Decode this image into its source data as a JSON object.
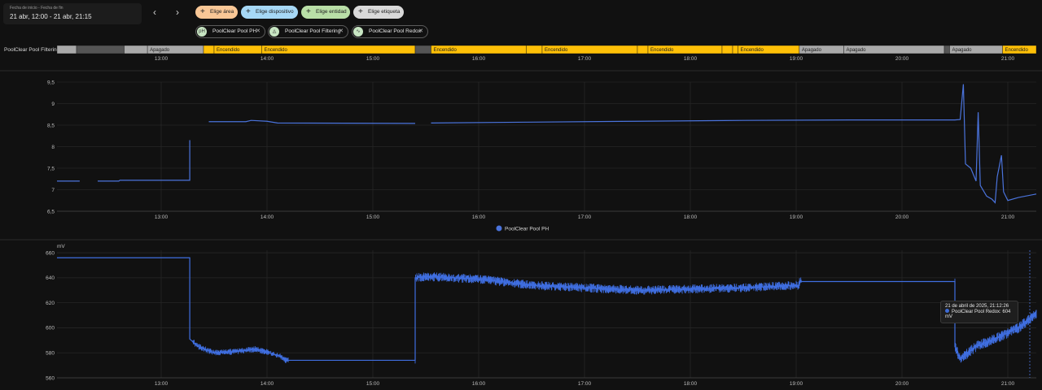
{
  "date_range": {
    "label": "Fecha de inicio - Fecha de fin",
    "value": "21 abr, 12:00 - 21 abr, 21:15"
  },
  "nav": {
    "prev": "‹",
    "next": "›"
  },
  "filters": {
    "area": "Elige área",
    "device": "Elige dispositivo",
    "entity": "Elige entidad",
    "tag": "Elige etiqueta"
  },
  "selected": [
    {
      "label": "PoolClear Pool PH",
      "icon": "ph-icon"
    },
    {
      "label": "PoolClear Pool Filtering",
      "icon": "water-icon"
    },
    {
      "label": "PoolClear Pool Redox",
      "icon": "wave-icon"
    }
  ],
  "timeline": {
    "entity_label": "PoolClear Pool Filtering",
    "colors": {
      "on": "#fec007",
      "off": "#a9a9a9",
      "unavailable": "#555555"
    },
    "segments": [
      {
        "state": "off",
        "start": 12.0,
        "end": 12.2
      },
      {
        "state": "unavailable",
        "start": 12.2,
        "end": 12.65
      },
      {
        "state": "off",
        "start": 12.65,
        "end": 12.87
      },
      {
        "state": "off",
        "start": 12.87,
        "end": 13.4,
        "label": "Apagado"
      },
      {
        "state": "on",
        "start": 13.4,
        "end": 13.5
      },
      {
        "state": "on",
        "start": 13.5,
        "end": 13.95,
        "label": "Encendido"
      },
      {
        "state": "on",
        "start": 13.95,
        "end": 15.4,
        "label": "Encendido"
      },
      {
        "state": "unavailable",
        "start": 15.4,
        "end": 15.55
      },
      {
        "state": "on",
        "start": 15.55,
        "end": 16.45,
        "label": "Encendido"
      },
      {
        "state": "on",
        "start": 16.45,
        "end": 16.6
      },
      {
        "state": "on",
        "start": 16.6,
        "end": 17.5,
        "label": "Encendido"
      },
      {
        "state": "on",
        "start": 17.5,
        "end": 17.6
      },
      {
        "state": "on",
        "start": 17.6,
        "end": 18.3,
        "label": "Encendido"
      },
      {
        "state": "on",
        "start": 18.3,
        "end": 18.4
      },
      {
        "state": "on",
        "start": 18.4,
        "end": 18.45
      },
      {
        "state": "on",
        "start": 18.45,
        "end": 19.03,
        "label": "Encendido"
      },
      {
        "state": "off",
        "start": 19.03,
        "end": 19.45,
        "label": "Apagado"
      },
      {
        "state": "off",
        "start": 19.45,
        "end": 20.4,
        "label": "Apagado"
      },
      {
        "state": "unavailable",
        "start": 20.4,
        "end": 20.45
      },
      {
        "state": "off",
        "start": 20.45,
        "end": 20.95,
        "label": "Apagado"
      },
      {
        "state": "on",
        "start": 20.95,
        "end": 21.3,
        "label": "Encendido"
      }
    ]
  },
  "time_ticks": [
    "13:00",
    "14:00",
    "15:00",
    "16:00",
    "17:00",
    "18:00",
    "19:00",
    "20:00",
    "21:00"
  ],
  "chart_data": [
    {
      "type": "line",
      "title": "",
      "series": [
        {
          "name": "PoolClear Pool PH",
          "color": "#4a73dc",
          "segments": [
            [
              [
                12.0,
                7.2
              ],
              [
                12.23,
                7.2
              ]
            ],
            [
              [
                12.4,
                7.2
              ],
              [
                12.6,
                7.2
              ],
              [
                12.61,
                7.22
              ],
              [
                13.27,
                7.22
              ],
              [
                13.27,
                8.15
              ]
            ],
            [
              [
                13.45,
                8.58
              ],
              [
                13.8,
                8.58
              ],
              [
                13.85,
                8.61
              ],
              [
                14.0,
                8.59
              ],
              [
                14.1,
                8.55
              ],
              [
                15.4,
                8.54
              ]
            ],
            [
              [
                15.55,
                8.55
              ],
              [
                16.5,
                8.57
              ],
              [
                17.5,
                8.59
              ],
              [
                18.5,
                8.61
              ],
              [
                19.5,
                8.62
              ],
              [
                20.5,
                8.62
              ],
              [
                20.55,
                8.63
              ],
              [
                20.58,
                9.45
              ],
              [
                20.6,
                7.6
              ],
              [
                20.65,
                7.5
              ],
              [
                20.7,
                7.2
              ],
              [
                20.72,
                8.8
              ],
              [
                20.74,
                7.1
              ],
              [
                20.8,
                6.85
              ],
              [
                20.85,
                6.78
              ],
              [
                20.88,
                6.7
              ],
              [
                20.9,
                7.3
              ],
              [
                20.94,
                7.8
              ],
              [
                20.96,
                6.95
              ],
              [
                21.0,
                6.75
              ],
              [
                21.1,
                6.82
              ],
              [
                21.3,
                6.9
              ]
            ]
          ]
        }
      ],
      "yticks": [
        6.5,
        7,
        7.5,
        8,
        8.5,
        9,
        9.5
      ],
      "ytick_labels": [
        "6,5",
        "7",
        "7,5",
        "8",
        "8,5",
        "9",
        "9,5"
      ],
      "ylim": [
        6.5,
        9.5
      ],
      "xlim": [
        12.0,
        21.3
      ],
      "legend_placement": "bottom-center",
      "grid": true
    },
    {
      "type": "line",
      "ylabel": "mV",
      "series": [
        {
          "name": "PoolClear Pool Redox",
          "color": "#3f6ee0",
          "segments": [
            [
              [
                12.0,
                656
              ],
              [
                13.27,
                656
              ],
              [
                13.27,
                591
              ],
              [
                13.35,
                585
              ],
              [
                13.5,
                580
              ],
              [
                13.7,
                581
              ],
              [
                13.9,
                583
              ],
              [
                14.1,
                578
              ],
              [
                14.17,
                575
              ],
              [
                14.17,
                574
              ],
              [
                15.4,
                574
              ],
              [
                15.4,
                640
              ],
              [
                15.5,
                641
              ],
              [
                16.0,
                639
              ],
              [
                16.5,
                634
              ],
              [
                17.0,
                632
              ],
              [
                17.5,
                630
              ],
              [
                18.0,
                631
              ],
              [
                18.5,
                632
              ],
              [
                19.03,
                634
              ],
              [
                19.03,
                637
              ],
              [
                20.5,
                637
              ],
              [
                20.5,
                585
              ],
              [
                20.55,
                575
              ],
              [
                20.7,
                585
              ],
              [
                20.9,
                592
              ],
              [
                21.1,
                600
              ],
              [
                21.3,
                613
              ]
            ]
          ],
          "noise": [
            [
              13.3,
              14.2,
              4
            ],
            [
              15.4,
              19.05,
              6
            ],
            [
              20.5,
              21.3,
              7
            ]
          ]
        }
      ],
      "yticks": [
        560,
        580,
        600,
        620,
        640,
        660
      ],
      "ytick_labels": [
        "560",
        "580",
        "600",
        "620",
        "640",
        "660"
      ],
      "ylim": [
        560,
        662
      ],
      "xlim": [
        12.0,
        21.3
      ],
      "grid": true
    }
  ],
  "tooltip": {
    "time": "21 de abril de 2025, 21:12:26",
    "entry": "PoolClear Pool Redox: 604 mV"
  }
}
